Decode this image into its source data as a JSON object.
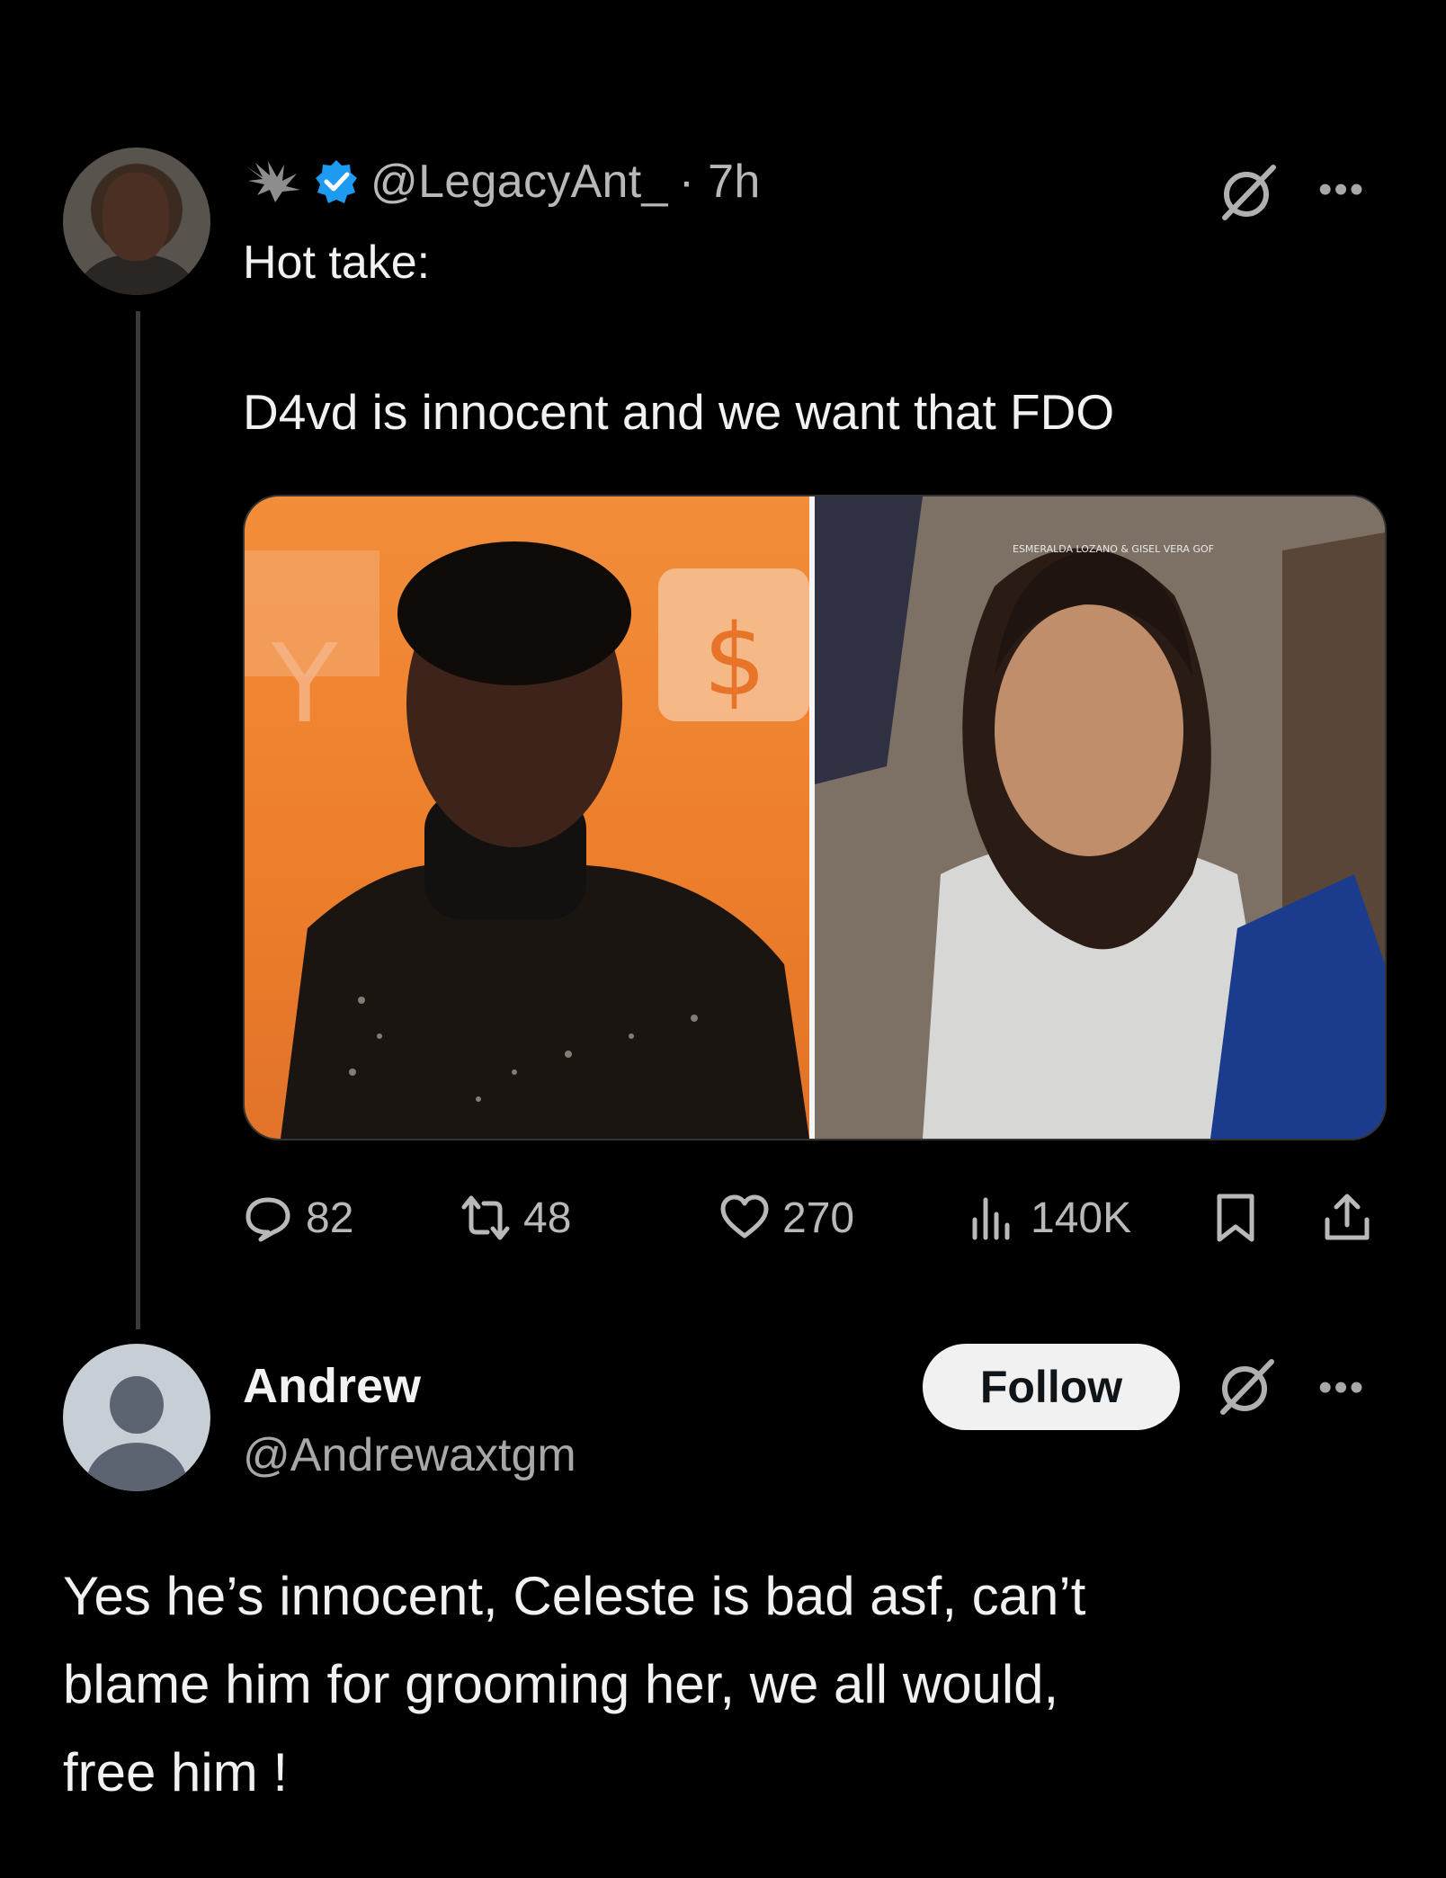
{
  "tweet": {
    "handle": "@LegacyAnt_",
    "time": "· 7h",
    "text_line1": "Hot take:",
    "text_line2": "D4vd is innocent and we want that FDO",
    "image_caption": "ESMERALDA LOZANO & GISEL VERA GOF",
    "image_sign": "Y",
    "image_dollar": "$",
    "stats": {
      "replies": "82",
      "reposts": "48",
      "likes": "270",
      "views": "140K"
    },
    "icons": [
      "plant-icon",
      "verified-icon",
      "grok-icon",
      "more-icon",
      "reply-icon",
      "repost-icon",
      "like-icon",
      "views-icon",
      "bookmark-icon",
      "share-icon"
    ]
  },
  "reply": {
    "name": "Andrew",
    "handle": "@Andrewaxtgm",
    "follow_label": "Follow",
    "body_lines": [
      "Yes he’s innocent, Celeste is bad asf, can’t",
      "blame him for grooming her, we all would,",
      "free him !"
    ]
  },
  "ui": {
    "more_glyph": "•••"
  },
  "colors": {
    "background": "#000000",
    "text": "#f1f1f1",
    "muted": "#b9b9b9",
    "verified": "#1d9bf0",
    "follow_bg": "#f1f1f1"
  }
}
